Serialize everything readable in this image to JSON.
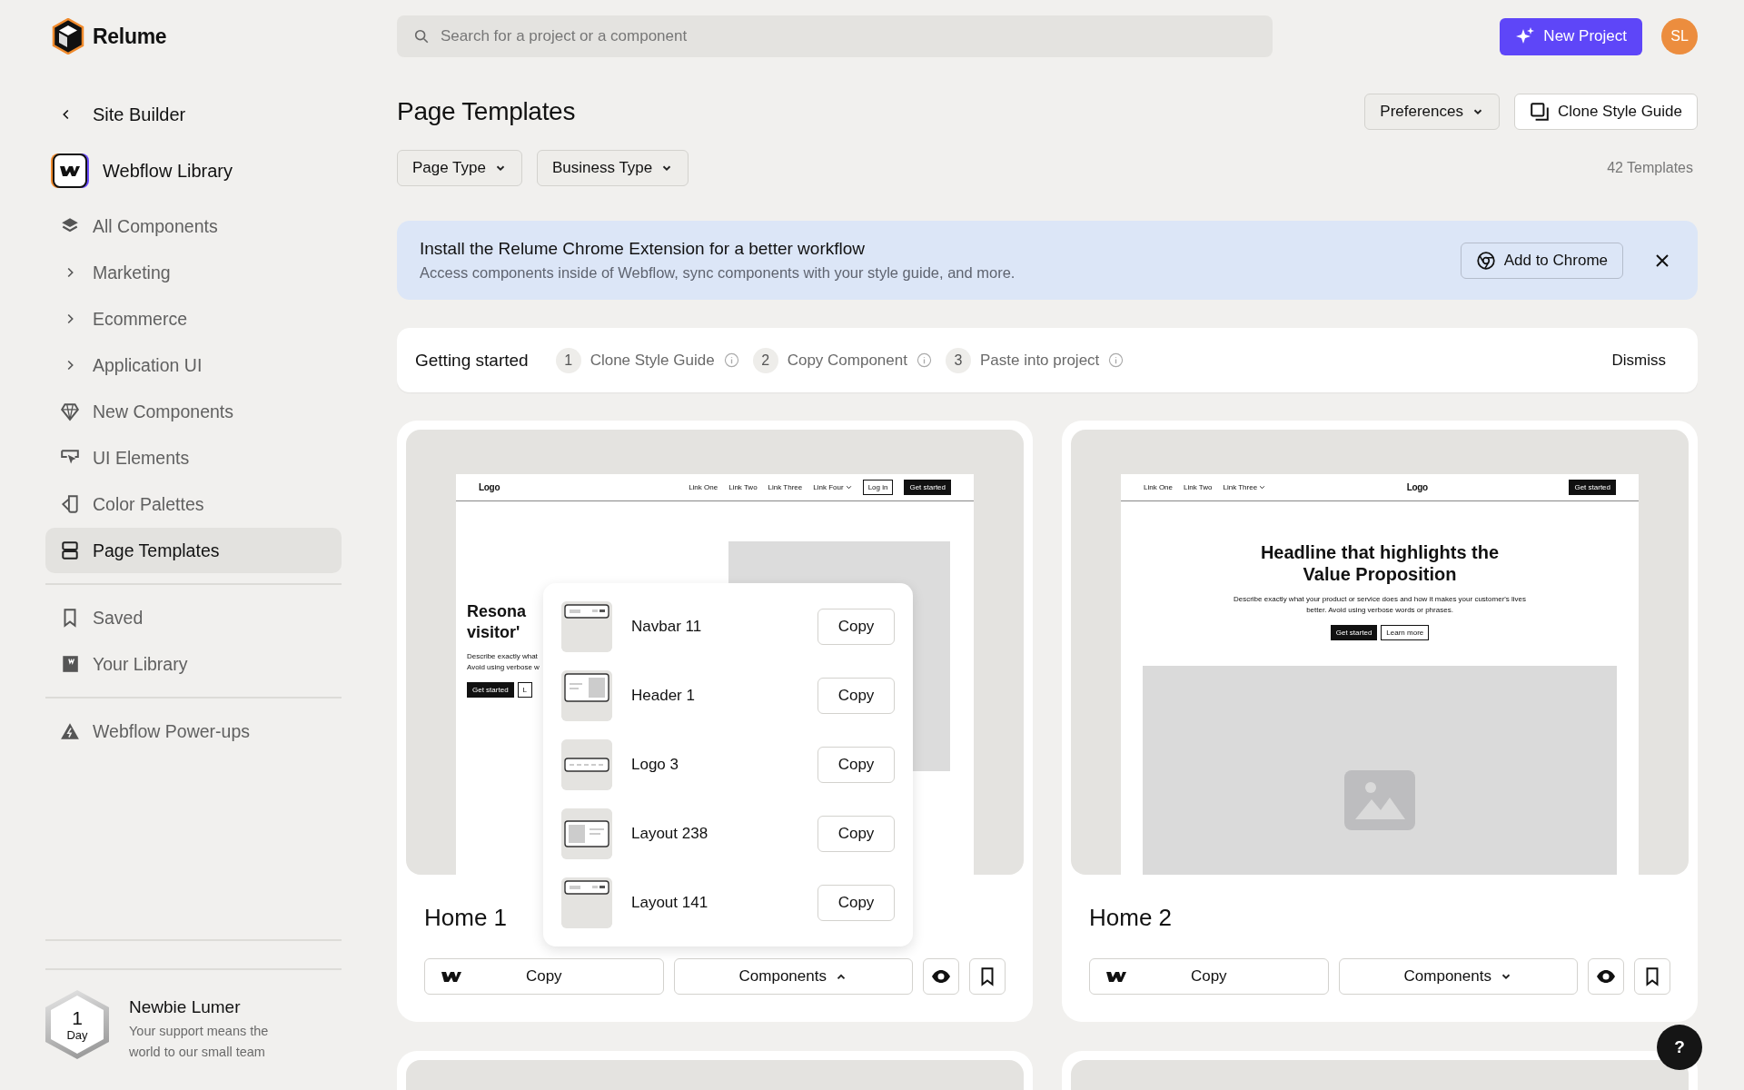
{
  "app": {
    "name": "Relume"
  },
  "sidebar": {
    "back_link": "Site Builder",
    "library": "Webflow Library",
    "items": [
      {
        "label": "All Components",
        "kind": "link",
        "selected": false
      },
      {
        "label": "Marketing",
        "kind": "group",
        "selected": false
      },
      {
        "label": "Ecommerce",
        "kind": "group",
        "selected": false
      },
      {
        "label": "Application UI",
        "kind": "group",
        "selected": false
      },
      {
        "label": "New Components",
        "kind": "link",
        "selected": false
      },
      {
        "label": "UI Elements",
        "kind": "link",
        "selected": false
      },
      {
        "label": "Color Palettes",
        "kind": "link",
        "selected": false
      },
      {
        "label": "Page Templates",
        "kind": "link",
        "selected": true
      }
    ],
    "saved_items": [
      {
        "label": "Saved",
        "selected": false
      },
      {
        "label": "Your Library",
        "selected": false
      }
    ],
    "extra_items": [
      {
        "label": "Webflow Power-ups",
        "selected": false
      }
    ],
    "membership": {
      "badge_number": "1",
      "badge_unit": "Day",
      "title": "Newbie Lumer",
      "message": "Your support means the world to our small team"
    }
  },
  "search": {
    "placeholder": "Search for a project or a component"
  },
  "new_project_button": "New Project",
  "avatar": "SL",
  "page": {
    "title": "Page Templates",
    "buttons": [
      {
        "label": "Preferences",
        "kind": "dropdown"
      },
      {
        "label": "Clone Style Guide",
        "kind": "clone"
      }
    ],
    "filters": [
      "Page Type",
      "Business Type"
    ],
    "count": "42 Templates"
  },
  "banner": {
    "title": "Install the Relume Chrome Extension for a better workflow",
    "text": "Access components inside of Webflow, sync components with your style guide, and more.",
    "button": "Add to Chrome"
  },
  "getting_started": {
    "title": "Getting started",
    "steps": [
      {
        "number": "1",
        "label": "Clone Style Guide"
      },
      {
        "number": "2",
        "label": "Copy Component"
      },
      {
        "number": "3",
        "label": "Paste into project"
      }
    ],
    "dismiss": "Dismiss"
  },
  "templates": [
    {
      "name": "Home 1",
      "copy_button": "Copy",
      "components_button": "Components",
      "components_expanded": true,
      "preview": {
        "kind": "split",
        "logo": "Logo",
        "links": [
          {
            "label": "Link One",
            "dropdown": false
          },
          {
            "label": "Link Two",
            "dropdown": false
          },
          {
            "label": "Link Three",
            "dropdown": false
          },
          {
            "label": "Link Four",
            "dropdown": true
          }
        ],
        "nav_buttons": [
          {
            "label": "Log in",
            "kind": "secondary"
          },
          {
            "label": "Get started",
            "kind": "primary"
          }
        ],
        "heading_lines": [
          "Resona",
          "visitor'"
        ],
        "description_lines": [
          "Describe exactly what",
          "Avoid using verbose w"
        ],
        "hero_buttons": [
          {
            "label": "Get started",
            "kind": "primary"
          },
          {
            "label": "L",
            "kind": "secondary"
          }
        ]
      },
      "components": [
        {
          "name": "Navbar 11",
          "button": "Copy"
        },
        {
          "name": "Header 1",
          "button": "Copy"
        },
        {
          "name": "Logo 3",
          "button": "Copy"
        },
        {
          "name": "Layout 238",
          "button": "Copy"
        },
        {
          "name": "Layout 141",
          "button": "Copy"
        }
      ]
    },
    {
      "name": "Home 2",
      "copy_button": "Copy",
      "components_button": "Components",
      "components_expanded": false,
      "preview": {
        "kind": "centered",
        "logo": "Logo",
        "links": [
          {
            "label": "Link One",
            "dropdown": false
          },
          {
            "label": "Link Two",
            "dropdown": false
          },
          {
            "label": "Link Three",
            "dropdown": true
          }
        ],
        "nav_buttons": [
          {
            "label": "Get started",
            "kind": "primary"
          }
        ],
        "heading_lines": [
          "Headline that highlights the Value Proposition"
        ],
        "description_lines": [
          "Describe exactly what your product or service does and how it makes your customer's lives better. Avoid using verbose words or phrases."
        ],
        "hero_buttons": [
          {
            "label": "Get started",
            "kind": "primary"
          },
          {
            "label": "Learn more",
            "kind": "secondary"
          }
        ]
      }
    },
    {
      "preview": {
        "kind": "blank"
      }
    },
    {
      "preview": {
        "kind": "blank"
      }
    }
  ],
  "help_button": "?"
}
